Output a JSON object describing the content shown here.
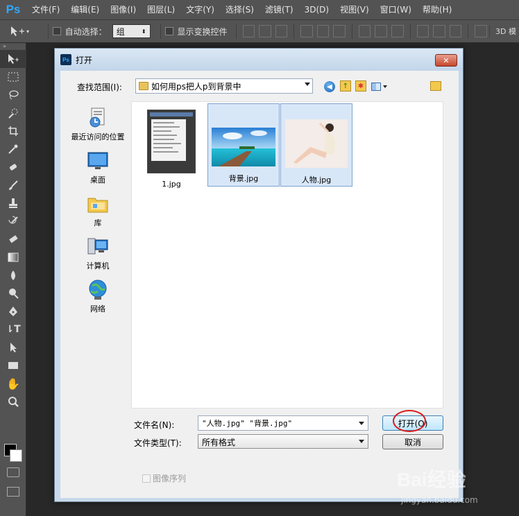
{
  "app": {
    "logo": "Ps",
    "menu": [
      "文件(F)",
      "编辑(E)",
      "图像(I)",
      "图层(L)",
      "文字(Y)",
      "选择(S)",
      "滤镜(T)",
      "3D(D)",
      "视图(V)",
      "窗口(W)",
      "帮助(H)"
    ]
  },
  "options_bar": {
    "auto_select_label": "自动选择：",
    "group_value": "组",
    "show_transform_label": "显示变换控件",
    "mode_3d_label": "3D 模"
  },
  "dialog": {
    "logo": "Ps",
    "title": "打开",
    "lookin_label": "查找范围(I):",
    "lookin_value": "如何用ps把人p到背景中",
    "places": [
      {
        "label": "最近访问的位置",
        "icon": "recent-places-icon"
      },
      {
        "label": "桌面",
        "icon": "desktop-icon"
      },
      {
        "label": "库",
        "icon": "library-icon"
      },
      {
        "label": "计算机",
        "icon": "computer-icon"
      },
      {
        "label": "网络",
        "icon": "network-icon"
      }
    ],
    "files": [
      {
        "name": "1.jpg",
        "selected": false
      },
      {
        "name": "背景.jpg",
        "selected": true
      },
      {
        "name": "人物.jpg",
        "selected": true
      }
    ],
    "filename_label": "文件名(N):",
    "filename_value": "\"人物.jpg\" \"背景.jpg\"",
    "filetype_label": "文件类型(T):",
    "filetype_value": "所有格式",
    "open_label": "打开(O)",
    "cancel_label": "取消",
    "image_sequence_label": "图像序列"
  },
  "watermark": {
    "logo": "Bai经验",
    "url": "jingyan.baidu.com"
  },
  "colors": {
    "selection_fill": "#d8e7f8",
    "selection_border": "#7da2ce",
    "annotation_circle": "#d81e1e",
    "ps_blue": "#31a8ff"
  }
}
